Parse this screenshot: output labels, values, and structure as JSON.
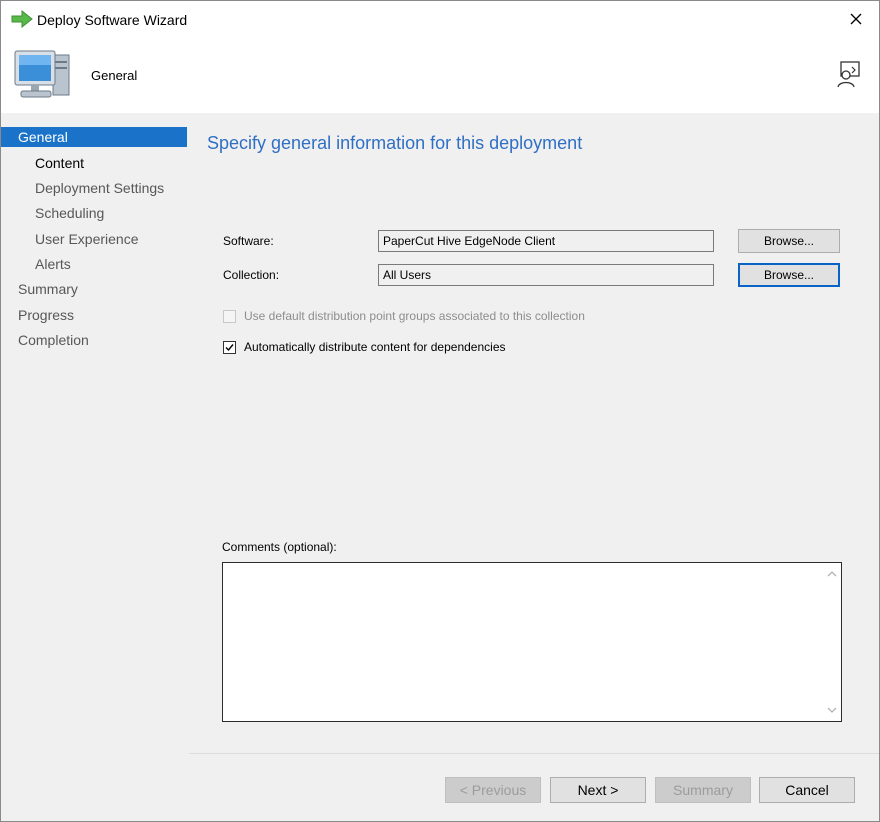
{
  "window": {
    "title": "Deploy Software Wizard"
  },
  "header": {
    "title": "General"
  },
  "nav": {
    "items": [
      {
        "label": "General"
      },
      {
        "label": "Content"
      },
      {
        "label": "Deployment Settings"
      },
      {
        "label": "Scheduling"
      },
      {
        "label": "User Experience"
      },
      {
        "label": "Alerts"
      },
      {
        "label": "Summary"
      },
      {
        "label": "Progress"
      },
      {
        "label": "Completion"
      }
    ]
  },
  "main": {
    "heading": "Specify general information for this deployment",
    "software": {
      "label": "Software:",
      "value": "PaperCut Hive EdgeNode Client",
      "browse_label": "Browse..."
    },
    "collection": {
      "label": "Collection:",
      "value": "All Users",
      "browse_label": "Browse..."
    },
    "use_default_dp": {
      "label": "Use default distribution point groups associated to this collection",
      "checked": false,
      "enabled": false
    },
    "auto_distribute": {
      "label": "Automatically distribute content for dependencies",
      "checked": true,
      "enabled": true
    },
    "comments": {
      "label": "Comments (optional):",
      "value": ""
    }
  },
  "footer": {
    "previous_label": "< Previous",
    "next_label": "Next >",
    "summary_label": "Summary",
    "cancel_label": "Cancel"
  },
  "colors": {
    "accent": "#1b73c9",
    "heading": "#2f6fc4",
    "panel": "#f0f0f0"
  }
}
